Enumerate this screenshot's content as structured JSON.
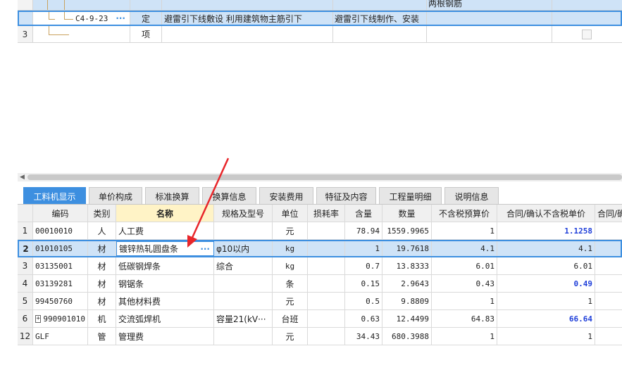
{
  "top_grid": {
    "partial_text": "两根钢筋",
    "rows": [
      {
        "code": "C4-9-23",
        "ellipsis": "···",
        "type": "定",
        "name": "避雷引下线敷设 利用建筑物主筋引下",
        "feature": "避雷引下线制作、安装"
      },
      {
        "num": "3",
        "type": "项"
      }
    ]
  },
  "tabs": [
    "工料机显示",
    "单价构成",
    "标准换算",
    "换算信息",
    "安装费用",
    "特征及内容",
    "工程量明细",
    "说明信息"
  ],
  "columns": [
    "编码",
    "类别",
    "名称",
    "规格及型号",
    "单位",
    "损耗率",
    "含量",
    "数量",
    "不含税预算价",
    "合同/确认不含税单价",
    "合同/确"
  ],
  "rows": [
    {
      "num": "1",
      "code": "00010010",
      "category": "人",
      "name": "人工费",
      "spec": "",
      "unit": "元",
      "loss": "",
      "content": "78.94",
      "quantity": "1559.9965",
      "price": "1",
      "contract": "1.1258"
    },
    {
      "num": "2",
      "code": "01010105",
      "category": "材",
      "name": "镀锌热轧圆盘条",
      "spec": "φ10以内",
      "unit": "kg",
      "loss": "",
      "content": "1",
      "quantity": "19.7618",
      "price": "4.1",
      "contract": "4.1"
    },
    {
      "num": "3",
      "code": "03135001",
      "category": "材",
      "name": "低碳钢焊条",
      "spec": "综合",
      "unit": "kg",
      "loss": "",
      "content": "0.7",
      "quantity": "13.8333",
      "price": "6.01",
      "contract": "6.01"
    },
    {
      "num": "4",
      "code": "03139281",
      "category": "材",
      "name": "钢锯条",
      "spec": "",
      "unit": "条",
      "loss": "",
      "content": "0.15",
      "quantity": "2.9643",
      "price": "0.43",
      "contract": "0.49"
    },
    {
      "num": "5",
      "code": "99450760",
      "category": "材",
      "name": "其他材料费",
      "spec": "",
      "unit": "元",
      "loss": "",
      "content": "0.5",
      "quantity": "9.8809",
      "price": "1",
      "contract": "1"
    },
    {
      "num": "6",
      "expand": "+",
      "code": "990901010",
      "category": "机",
      "name": "交流弧焊机",
      "spec": "容量21(kV···",
      "unit": "台班",
      "loss": "",
      "content": "0.63",
      "quantity": "12.4499",
      "price": "64.83",
      "contract": "66.64"
    },
    {
      "num": "12",
      "code": "GLF",
      "category": "管",
      "name": "管理费",
      "spec": "",
      "unit": "元",
      "loss": "",
      "content": "34.43",
      "quantity": "680.3988",
      "price": "1",
      "contract": "1"
    }
  ],
  "row2_ellipsis": "···",
  "colors": {
    "accent": "#3d8fe0",
    "selected": "#cfe3f7",
    "highlight_blue": "#1f3fd9",
    "arrow": "#e8262a"
  }
}
